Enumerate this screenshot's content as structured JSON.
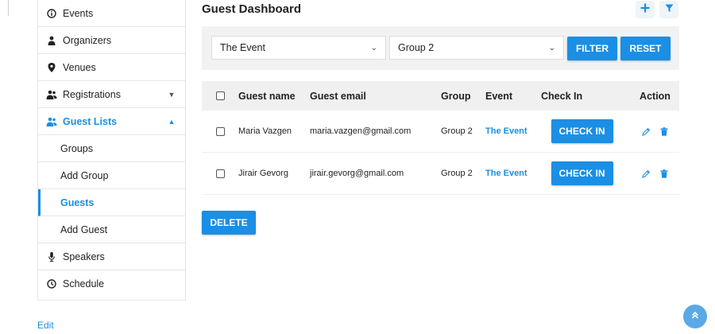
{
  "sidebar": {
    "items": [
      {
        "label": "Events",
        "icon": "info-circle-icon"
      },
      {
        "label": "Organizers",
        "icon": "user-tie-icon"
      },
      {
        "label": "Venues",
        "icon": "map-pin-icon"
      },
      {
        "label": "Registrations",
        "icon": "users-icon",
        "caret": "▼"
      },
      {
        "label": "Guest Lists",
        "icon": "users-icon",
        "caret": "▲"
      },
      {
        "label": "Groups"
      },
      {
        "label": "Add Group"
      },
      {
        "label": "Guests"
      },
      {
        "label": "Add Guest"
      },
      {
        "label": "Speakers",
        "icon": "microphone-icon"
      },
      {
        "label": "Schedule",
        "icon": "clock-icon"
      }
    ],
    "edit_label": "Edit"
  },
  "header": {
    "title": "Guest Dashboard"
  },
  "filters": {
    "event_value": "The Event",
    "group_value": "Group 2",
    "filter_label": "FILTER",
    "reset_label": "RESET"
  },
  "table": {
    "columns": [
      "Guest name",
      "Guest email",
      "Group",
      "Event",
      "Check In",
      "Action"
    ],
    "rows": [
      {
        "name": "Maria Vazgen",
        "email": "maria.vazgen@gmail.com",
        "group": "Group 2",
        "event": "The Event",
        "checkin_label": "CHECK IN"
      },
      {
        "name": "Jirair Gevorg",
        "email": "jirair.gevorg@gmail.com",
        "group": "Group 2",
        "event": "The Event",
        "checkin_label": "CHECK IN"
      }
    ]
  },
  "actions": {
    "delete_label": "DELETE"
  },
  "colors": {
    "accent": "#1a8fe5"
  }
}
